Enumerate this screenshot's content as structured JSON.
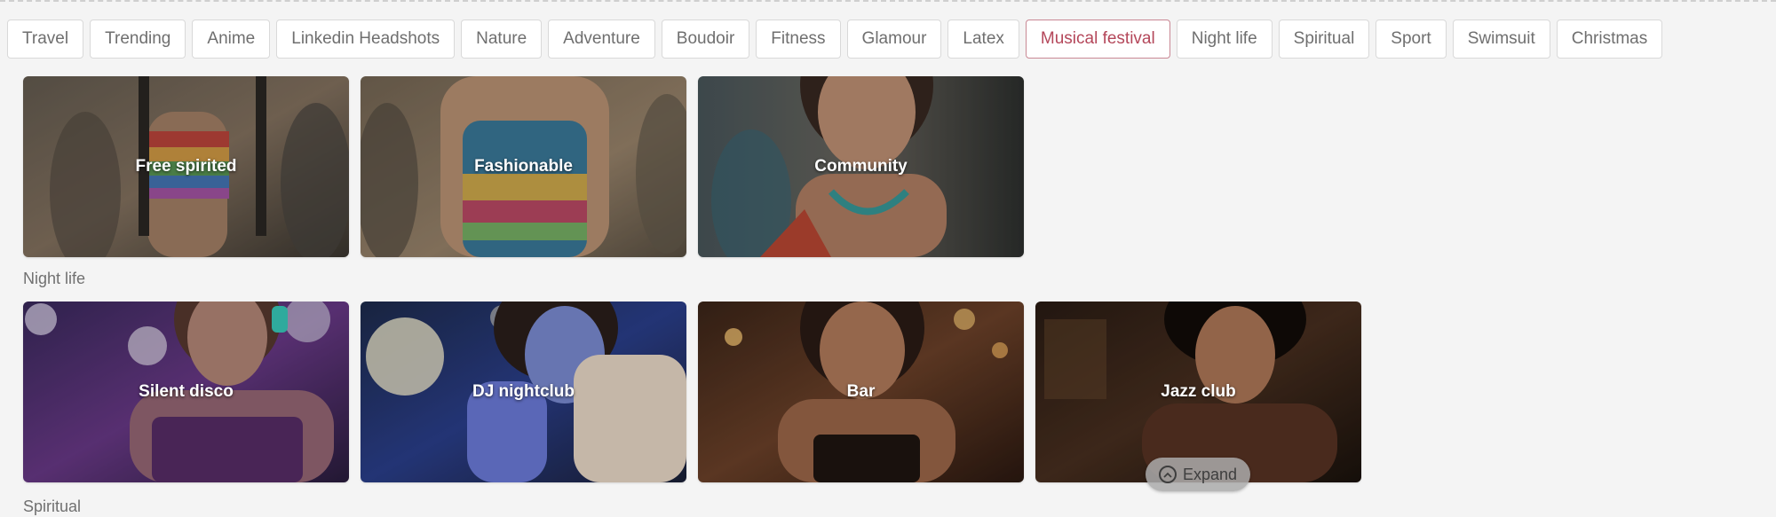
{
  "filters": [
    {
      "label": "Travel",
      "active": false
    },
    {
      "label": "Trending",
      "active": false
    },
    {
      "label": "Anime",
      "active": false
    },
    {
      "label": "Linkedin Headshots",
      "active": false
    },
    {
      "label": "Nature",
      "active": false
    },
    {
      "label": "Adventure",
      "active": false
    },
    {
      "label": "Boudoir",
      "active": false
    },
    {
      "label": "Fitness",
      "active": false
    },
    {
      "label": "Glamour",
      "active": false
    },
    {
      "label": "Latex",
      "active": false
    },
    {
      "label": "Musical festival",
      "active": true
    },
    {
      "label": "Night life",
      "active": false
    },
    {
      "label": "Spiritual",
      "active": false
    },
    {
      "label": "Sport",
      "active": false
    },
    {
      "label": "Swimsuit",
      "active": false
    },
    {
      "label": "Christmas",
      "active": false
    }
  ],
  "festival_cards": [
    {
      "title": "Free spirited"
    },
    {
      "title": "Fashionable"
    },
    {
      "title": "Community"
    }
  ],
  "nightlife": {
    "label": "Night life",
    "cards": [
      {
        "title": "Silent disco"
      },
      {
        "title": "DJ nightclub"
      },
      {
        "title": "Bar"
      },
      {
        "title": "Jazz club"
      }
    ]
  },
  "spiritual": {
    "label": "Spiritual"
  },
  "expand": {
    "label": "Expand"
  },
  "colors": {
    "accent": "#b4475a",
    "accent_border": "#c98894"
  }
}
